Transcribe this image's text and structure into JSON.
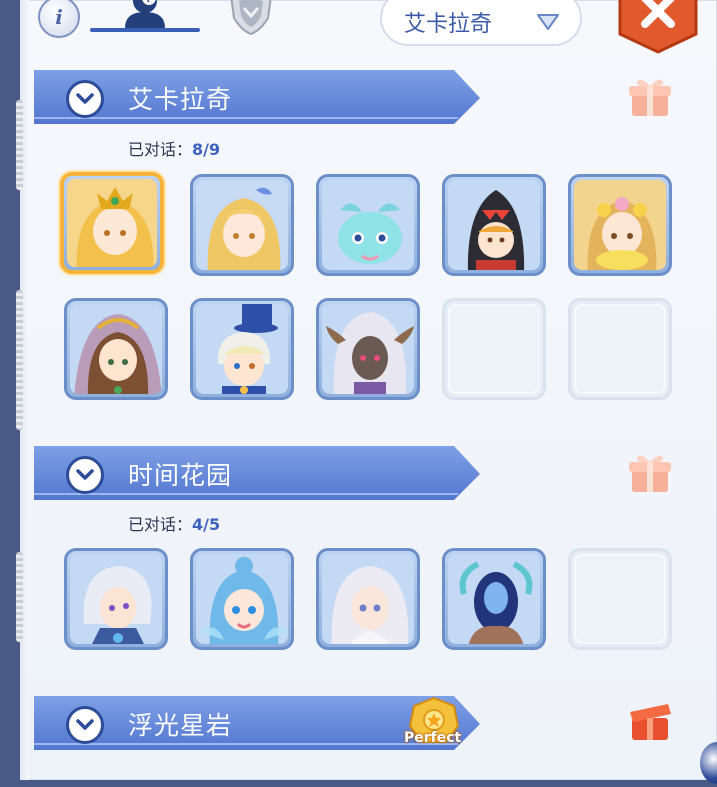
{
  "header": {
    "info_icon": "i",
    "tabs": [
      {
        "name": "npc-tab",
        "icon": "person-icon",
        "active": true
      },
      {
        "name": "faction-tab",
        "icon": "shield-icon",
        "active": false
      }
    ],
    "region_select": {
      "value": "艾卡拉奇"
    },
    "close_icon": "close-icon"
  },
  "sections": [
    {
      "title": "艾卡拉奇",
      "progress_label": "已对话：",
      "progress_value": "8/9",
      "progress": {
        "done": 8,
        "total": 9
      },
      "reward_icon": "gift-box-icon",
      "perfect": false,
      "cards": [
        {
          "portrait": "golden-crowned-elf",
          "selected": true
        },
        {
          "portrait": "blonde-fairy",
          "selected": false
        },
        {
          "portrait": "cyan-axolotl-spirit",
          "selected": false
        },
        {
          "portrait": "penguin-hood-kid",
          "selected": false
        },
        {
          "portrait": "flower-crown-girl",
          "selected": false
        },
        {
          "portrait": "veiled-brown-hair-girl",
          "selected": false
        },
        {
          "portrait": "top-hat-boy",
          "selected": false
        },
        {
          "portrait": "white-haired-dark-elf",
          "selected": false
        },
        {
          "portrait": "empty",
          "selected": false
        },
        {
          "portrait": "empty",
          "selected": false
        }
      ]
    },
    {
      "title": "时间花园",
      "progress_label": "已对话：",
      "progress_value": "4/5",
      "progress": {
        "done": 4,
        "total": 5
      },
      "reward_icon": "gift-box-icon",
      "perfect": false,
      "cards": [
        {
          "portrait": "white-haired-warrior",
          "selected": false
        },
        {
          "portrait": "blue-haired-fairy",
          "selected": false
        },
        {
          "portrait": "silver-haired-elf",
          "selected": false
        },
        {
          "portrait": "masked-guardian",
          "selected": false
        },
        {
          "portrait": "empty",
          "selected": false
        }
      ]
    },
    {
      "title": "浮光星岩",
      "perfect": true,
      "perfect_label": "Perfect",
      "reward_icon": "open-gift-box-icon"
    }
  ],
  "colors": {
    "accent": "#3d63c1",
    "banner": "#5b83d6",
    "selected": "#f4b43b"
  }
}
